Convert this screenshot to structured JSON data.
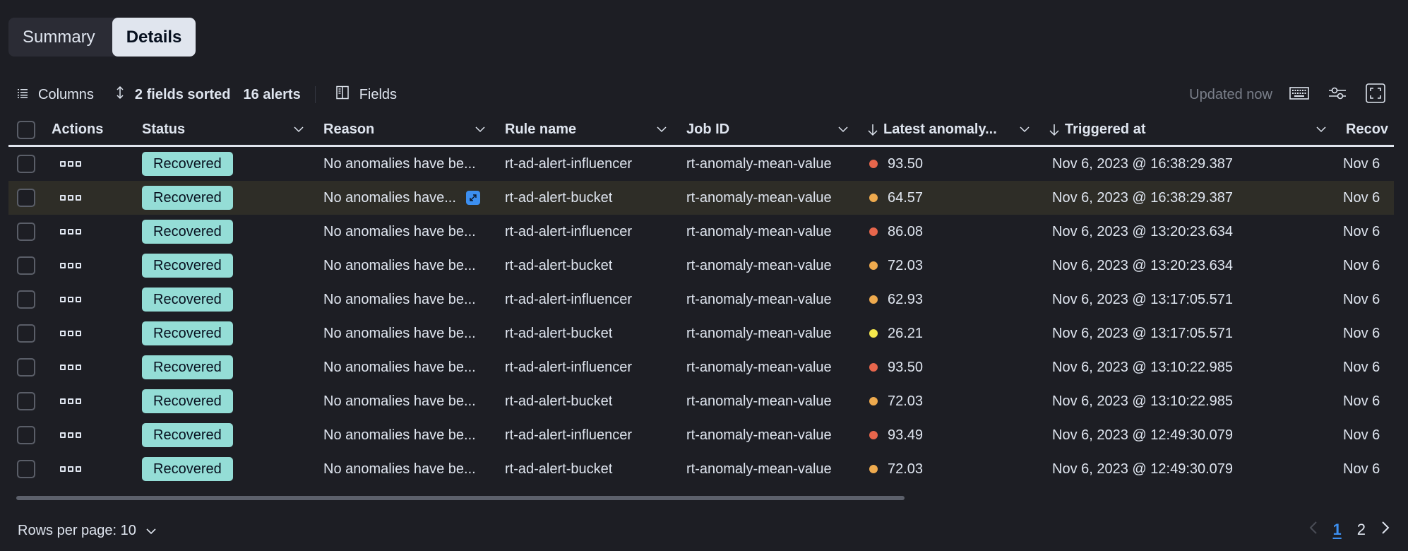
{
  "tabs": [
    {
      "label": "Summary",
      "active": false
    },
    {
      "label": "Details",
      "active": true
    }
  ],
  "toolbar": {
    "columns_label": "Columns",
    "sorted_label": "2 fields sorted",
    "alerts_count": "16 alerts",
    "fields_label": "Fields",
    "updated_label": "Updated now",
    "icons": [
      "keyboard-icon",
      "display-settings-icon",
      "fullscreen-icon"
    ]
  },
  "columns": [
    {
      "key": "actions",
      "label": "Actions",
      "sort": null
    },
    {
      "key": "status",
      "label": "Status",
      "sort": null
    },
    {
      "key": "reason",
      "label": "Reason",
      "sort": null
    },
    {
      "key": "rule",
      "label": "Rule name",
      "sort": null
    },
    {
      "key": "job",
      "label": "Job ID",
      "sort": null
    },
    {
      "key": "anomaly",
      "label": "Latest anomaly...",
      "sort": "desc"
    },
    {
      "key": "triggered",
      "label": "Triggered at",
      "sort": "desc"
    },
    {
      "key": "recovered",
      "label": "Recov",
      "sort": null
    }
  ],
  "severity_colors": {
    "critical": "#e7664c",
    "major": "#eeaa4e",
    "minor": "#f5e94c"
  },
  "rows": [
    {
      "status": "Recovered",
      "reason": "No anomalies have be...",
      "rule": "rt-ad-alert-influencer",
      "job": "rt-anomaly-mean-value",
      "severity": "critical",
      "anomaly": "93.50",
      "triggered": "Nov 6, 2023 @ 16:38:29.387",
      "recovered": "Nov 6",
      "highlighted": false
    },
    {
      "status": "Recovered",
      "reason": "No anomalies have...",
      "rule": "rt-ad-alert-bucket",
      "job": "rt-anomaly-mean-value",
      "severity": "major",
      "anomaly": "64.57",
      "triggered": "Nov 6, 2023 @ 16:38:29.387",
      "recovered": "Nov 6",
      "highlighted": true
    },
    {
      "status": "Recovered",
      "reason": "No anomalies have be...",
      "rule": "rt-ad-alert-influencer",
      "job": "rt-anomaly-mean-value",
      "severity": "critical",
      "anomaly": "86.08",
      "triggered": "Nov 6, 2023 @ 13:20:23.634",
      "recovered": "Nov 6",
      "highlighted": false
    },
    {
      "status": "Recovered",
      "reason": "No anomalies have be...",
      "rule": "rt-ad-alert-bucket",
      "job": "rt-anomaly-mean-value",
      "severity": "major",
      "anomaly": "72.03",
      "triggered": "Nov 6, 2023 @ 13:20:23.634",
      "recovered": "Nov 6",
      "highlighted": false
    },
    {
      "status": "Recovered",
      "reason": "No anomalies have be...",
      "rule": "rt-ad-alert-influencer",
      "job": "rt-anomaly-mean-value",
      "severity": "major",
      "anomaly": "62.93",
      "triggered": "Nov 6, 2023 @ 13:17:05.571",
      "recovered": "Nov 6",
      "highlighted": false
    },
    {
      "status": "Recovered",
      "reason": "No anomalies have be...",
      "rule": "rt-ad-alert-bucket",
      "job": "rt-anomaly-mean-value",
      "severity": "minor",
      "anomaly": "26.21",
      "triggered": "Nov 6, 2023 @ 13:17:05.571",
      "recovered": "Nov 6",
      "highlighted": false
    },
    {
      "status": "Recovered",
      "reason": "No anomalies have be...",
      "rule": "rt-ad-alert-influencer",
      "job": "rt-anomaly-mean-value",
      "severity": "critical",
      "anomaly": "93.50",
      "triggered": "Nov 6, 2023 @ 13:10:22.985",
      "recovered": "Nov 6",
      "highlighted": false
    },
    {
      "status": "Recovered",
      "reason": "No anomalies have be...",
      "rule": "rt-ad-alert-bucket",
      "job": "rt-anomaly-mean-value",
      "severity": "major",
      "anomaly": "72.03",
      "triggered": "Nov 6, 2023 @ 13:10:22.985",
      "recovered": "Nov 6",
      "highlighted": false
    },
    {
      "status": "Recovered",
      "reason": "No anomalies have be...",
      "rule": "rt-ad-alert-influencer",
      "job": "rt-anomaly-mean-value",
      "severity": "critical",
      "anomaly": "93.49",
      "triggered": "Nov 6, 2023 @ 12:49:30.079",
      "recovered": "Nov 6",
      "highlighted": false
    },
    {
      "status": "Recovered",
      "reason": "No anomalies have be...",
      "rule": "rt-ad-alert-bucket",
      "job": "rt-anomaly-mean-value",
      "severity": "major",
      "anomaly": "72.03",
      "triggered": "Nov 6, 2023 @ 12:49:30.079",
      "recovered": "Nov 6",
      "highlighted": false
    }
  ],
  "footer": {
    "rows_per_page_label": "Rows per page: 10",
    "pages": [
      "1",
      "2"
    ],
    "current_page": "1"
  }
}
